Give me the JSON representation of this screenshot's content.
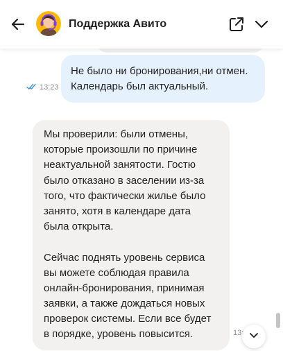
{
  "header": {
    "title": "Поддержка Авито",
    "back_icon": "arrow-left-icon",
    "open_icon": "open-external-icon",
    "collapse_icon": "chevron-down-icon"
  },
  "messages": [
    {
      "direction": "outgoing",
      "lines": [
        "Не было ни бронирования,ни отмен.",
        "Календарь был актуальный."
      ],
      "time": "13:23",
      "status_icon": "double-check-icon"
    },
    {
      "direction": "incoming",
      "lines": [
        "Мы проверили: были отмены,",
        "которые произошли по причине",
        "неактуальной занятости. Гостю",
        "было отказано в заселении из-за",
        "того, что фактически жилье было",
        "занято, хотя в календаре дата",
        "была открыта.",
        "",
        "Сейчас поднять уровень сервиса",
        "вы можете соблюдая правила",
        "онлайн-бронирования, принимая",
        "заявки, а также дождаться новых",
        "проверок системы. Если все будет",
        "в порядке, уровень повысится."
      ],
      "time": "13:"
    }
  ],
  "colors": {
    "outgoing_bubble": "#e5f2fd",
    "incoming_bubble": "#f2f1f0",
    "read_check": "#2f8bd9",
    "avatar_bg": "#ffb900",
    "headset": "#7b3fe4"
  }
}
